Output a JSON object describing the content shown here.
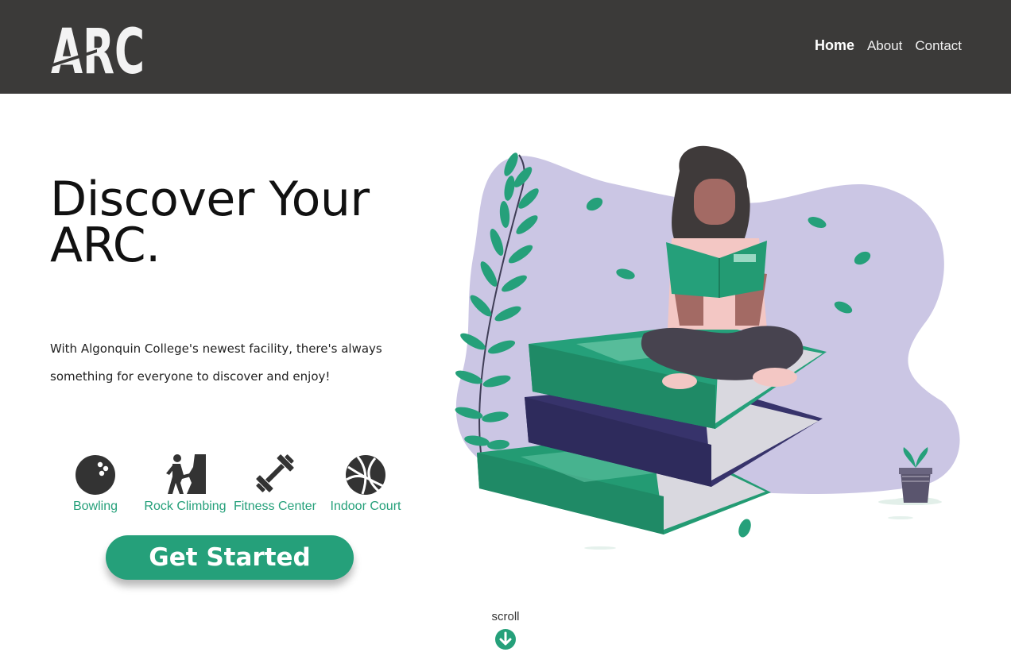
{
  "header": {
    "logo_text": "ARC",
    "nav": [
      {
        "label": "Home",
        "active": true
      },
      {
        "label": "About",
        "active": false
      },
      {
        "label": "Contact",
        "active": false
      }
    ]
  },
  "hero": {
    "title": "Discover Your ARC.",
    "description": "With Algonquin College's newest facility, there's always something for everyone to discover and enjoy!"
  },
  "features": [
    {
      "label": "Bowling",
      "icon": "bowling-ball-icon"
    },
    {
      "label": "Rock Climbing",
      "icon": "rock-climbing-icon"
    },
    {
      "label": "Fitness Center",
      "icon": "dumbbell-icon"
    },
    {
      "label": "Indoor Court",
      "icon": "basketball-icon"
    }
  ],
  "cta": {
    "label": "Get Started"
  },
  "scroll": {
    "label": "scroll",
    "icon": "arrow-down-circle-icon"
  },
  "colors": {
    "header_bg": "#3b3a39",
    "accent": "#25a07a",
    "blob": "#cbc6e4",
    "navy_book": "#37336b"
  }
}
